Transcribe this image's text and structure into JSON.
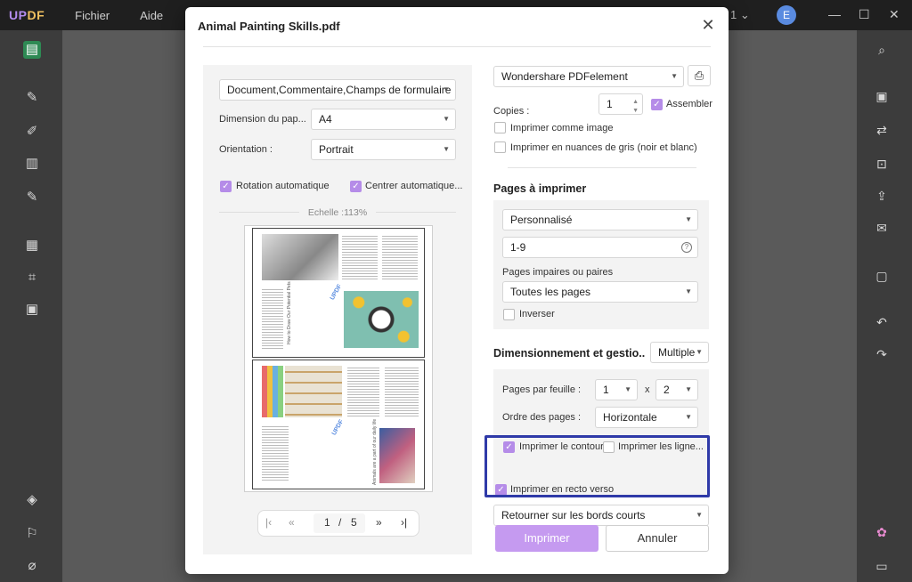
{
  "app": {
    "logo_left": "UP",
    "logo_right": "DF",
    "menu": [
      "Fichier",
      "Aide"
    ],
    "tab_count": "1",
    "avatar_letter": "E"
  },
  "dialog": {
    "title": "Animal Painting Skills.pdf",
    "content_select": "Document,Commentaire,Champs de formulaire",
    "paper_size_label": "Dimension du pap...",
    "paper_size_value": "A4",
    "orientation_label": "Orientation :",
    "orientation_value": "Portrait",
    "auto_rotate_label": "Rotation automatique",
    "auto_center_label": "Centrer automatique...",
    "scale_label": "Echelle :113%",
    "pager": {
      "current": "1",
      "separator": "/",
      "total": "5"
    },
    "preview_text": {
      "mark": "UPDF",
      "title1": "How to Draw Our Potential Pets",
      "title2": "Animals are a part of our daily life"
    },
    "printer_value": "Wondershare PDFelement",
    "copies_label": "Copies :",
    "copies_value": "1",
    "collate_label": "Assembler",
    "print_as_image_label": "Imprimer comme image",
    "grayscale_label": "Imprimer en nuances de gris (noir et blanc)",
    "pages_section_title": "Pages à imprimer",
    "pages_mode_value": "Personnalisé",
    "pages_range_value": "1-9",
    "odd_even_label": "Pages impaires ou paires",
    "odd_even_value": "Toutes les pages",
    "reverse_label": "Inverser",
    "sizing_section_title": "Dimensionnement et gestio..",
    "sizing_mode_value": "Multiple",
    "pages_per_sheet_label": "Pages par feuille :",
    "pages_per_sheet_cols": "1",
    "pages_per_sheet_x": "x",
    "pages_per_sheet_rows": "2",
    "page_order_label": "Ordre des pages :",
    "page_order_value": "Horizontale",
    "print_border_label": "Imprimer le contour",
    "print_lines_label": "Imprimer les ligne...",
    "duplex_label": "Imprimer en recto verso",
    "duplex_flip_value": "Retourner sur les bords courts",
    "print_button": "Imprimer",
    "cancel_button": "Annuler"
  },
  "checkbox_states": {
    "auto_rotate": true,
    "auto_center": true,
    "collate": true,
    "print_as_image": false,
    "grayscale": false,
    "reverse": false,
    "print_border": true,
    "print_lines": false,
    "duplex": true
  },
  "colors": {
    "accent": "#b58ce8",
    "print_button": "#c59af0",
    "highlight_box": "#2f3aa8",
    "active_tool": "#2e8a54"
  }
}
